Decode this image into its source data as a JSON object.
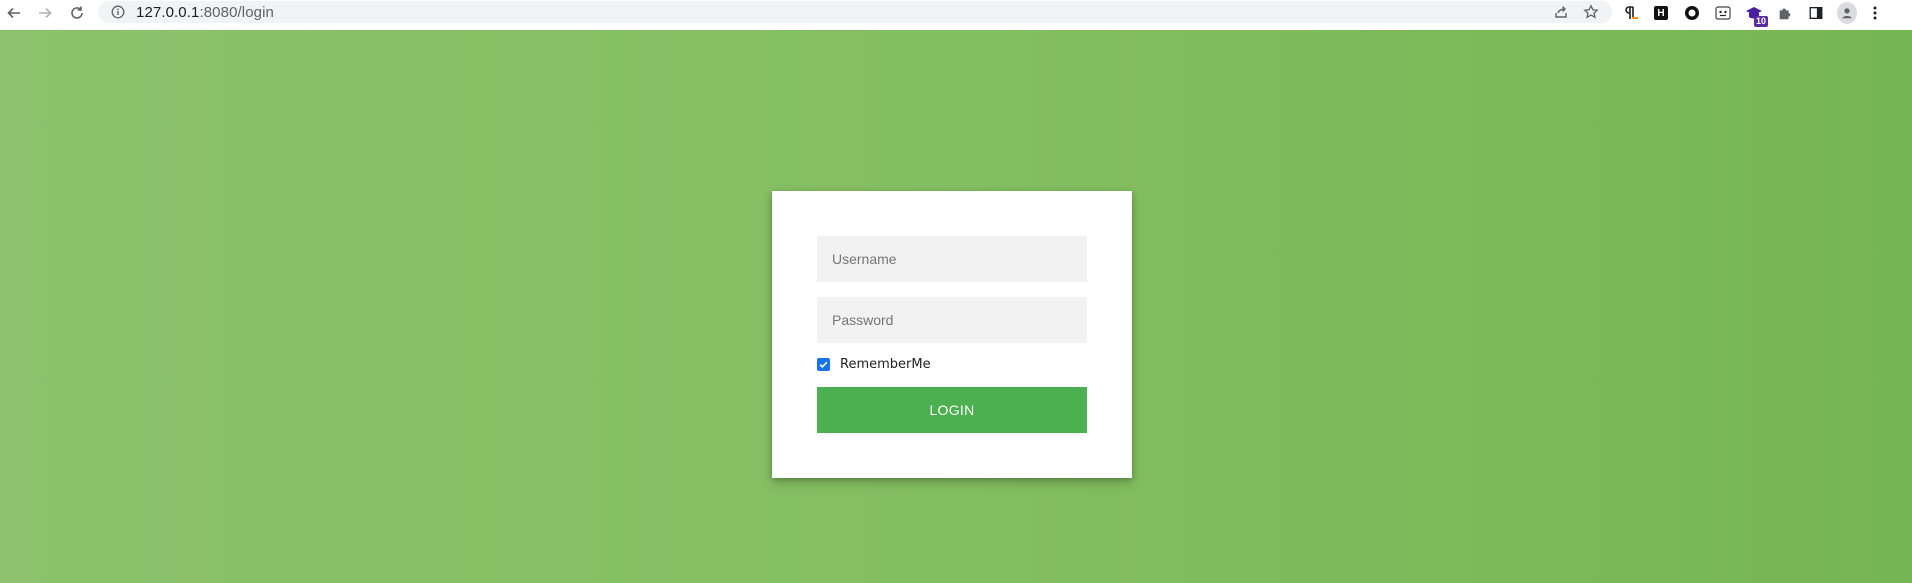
{
  "browser": {
    "url_host": "127.0.0.1",
    "url_path": ":8080/login",
    "extensions": [
      {
        "icon": "pilcrow-extension-icon"
      },
      {
        "icon": "h-extension-icon",
        "label": "H"
      },
      {
        "icon": "circle-extension-icon"
      },
      {
        "icon": "face-extension-icon"
      },
      {
        "icon": "cap-extension-icon",
        "badge": "10"
      },
      {
        "icon": "puzzle-icon"
      },
      {
        "icon": "side-panel-icon"
      },
      {
        "icon": "profile-avatar-icon"
      },
      {
        "icon": "kebab-menu-icon"
      }
    ]
  },
  "login": {
    "username_placeholder": "Username",
    "password_placeholder": "Password",
    "remember_label": "RememberMe",
    "remember_checked": true,
    "button_label": "LOGIN"
  },
  "colors": {
    "background_start": "#8bc26b",
    "background_end": "#76b652",
    "button": "#4caf50",
    "checkbox": "#1a73e8"
  }
}
